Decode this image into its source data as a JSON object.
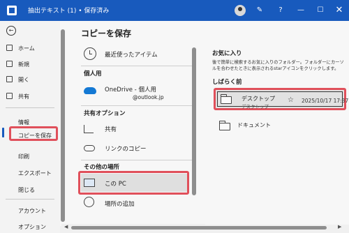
{
  "window": {
    "title": "抽出テキスト (1) • 保存済み",
    "help_label": "?",
    "minimize_label": "—",
    "maximize_label": "☐",
    "close_label": "✕"
  },
  "sidebar": {
    "back_label": "←",
    "items": [
      {
        "label": "ホーム"
      },
      {
        "label": "新規"
      },
      {
        "label": "開く"
      },
      {
        "label": "共有"
      },
      {
        "label": "情報"
      },
      {
        "label": "コピーを保存"
      },
      {
        "label": "印刷"
      },
      {
        "label": "エクスポート"
      },
      {
        "label": "閉じる"
      },
      {
        "label": "アカウント"
      },
      {
        "label": "オプション"
      }
    ]
  },
  "main": {
    "title": "コピーを保存",
    "recent_label": "最近使ったアイテム",
    "personal_section": "個人用",
    "onedrive_label": "OneDrive - 個人用",
    "onedrive_email": "@outlook.jp",
    "share_section": "共有オプション",
    "share_label": "共有",
    "link_label": "リンクのコピー",
    "other_section": "その他の場所",
    "this_pc_label": "この PC",
    "add_location_label": "場所の追加"
  },
  "right": {
    "favorites_title": "お気に入り",
    "favorites_desc": "後で簡単に検索するお気に入りのフォルダー。フォルダーにカーソルを合わせたときに表示されるstarアイコンをクリックします。",
    "recent_title": "しばらく前",
    "recent_folder": {
      "name": "デスクトップ",
      "path": "デスクトップ",
      "date": "2025/10/17 17:37"
    },
    "documents_label": "ドキュメント"
  },
  "colors": {
    "titlebar": "#185abd",
    "highlight": "#e0505b",
    "onedrive": "#1479d4"
  }
}
